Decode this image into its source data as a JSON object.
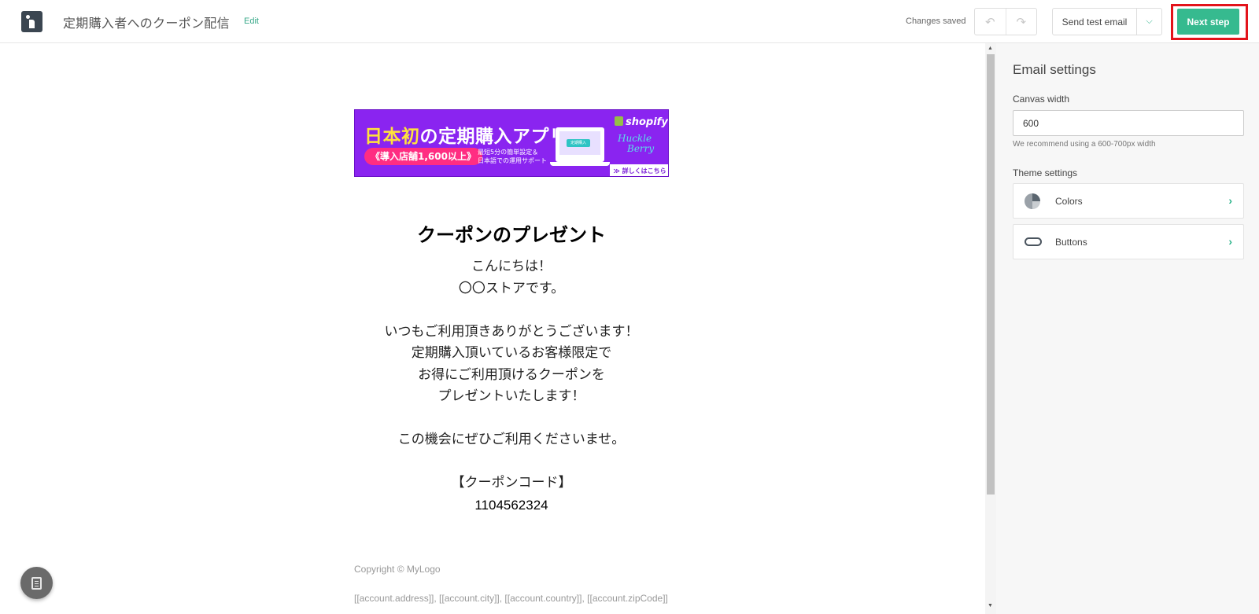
{
  "header": {
    "title": "定期購入者へのクーポン配信",
    "edit_label": "Edit",
    "status": "Changes saved",
    "undo_icon": "undo-icon",
    "redo_icon": "redo-icon",
    "send_test_label": "Send test email",
    "next_label": "Next step"
  },
  "banner": {
    "title_highlight": "日本初",
    "title_rest": "の定期購入アプリ",
    "pill": "《導入店舗1,600以上》",
    "sub_line1": "最短5分の簡単設定＆",
    "sub_line2": "日本語での運用サポート",
    "screen_button": "定期購入",
    "shopify": "shopify",
    "brand_line1": "Huckle",
    "brand_line2": "Berry",
    "detail": "≫ 詳しくはこちら"
  },
  "email": {
    "heading": "クーポンのプレゼント",
    "lines": [
      "こんにちは！",
      "〇〇ストアです。",
      "",
      "いつもご利用頂きありがとうございます！",
      "定期購入頂いているお客様限定で",
      "お得にご利用頂けるクーポンを",
      "プレゼントいたします！",
      "",
      "この機会にぜひご利用くださいませ。",
      "",
      "【クーポンコード】"
    ],
    "coupon_code": "1104562324",
    "copyright": "Copyright © MyLogo",
    "address": "[[account.address]], [[account.city]], [[account.country]], [[account.zipCode]]"
  },
  "panel": {
    "title": "Email settings",
    "canvas_width_label": "Canvas width",
    "canvas_width_value": "600",
    "canvas_width_hint": "We recommend using a 600-700px width",
    "theme_label": "Theme settings",
    "colors_label": "Colors",
    "buttons_label": "Buttons"
  },
  "colors": {
    "accent": "#36ba8f",
    "highlight_border": "#e3131b",
    "banner_bg": "#8a24f0"
  }
}
